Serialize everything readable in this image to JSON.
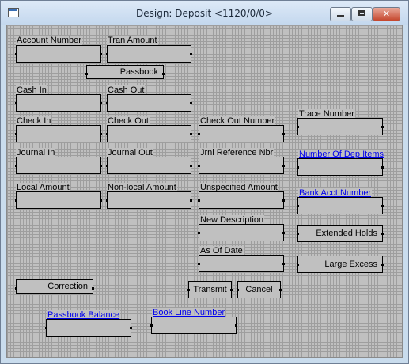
{
  "window": {
    "title": "Design: Deposit <1120/0/0>",
    "controls": {
      "minimize": "minimize",
      "maximize": "maximize",
      "close": "✕"
    }
  },
  "labels": {
    "account_number": "Account Number",
    "tran_amount": "Tran Amount",
    "cash_in": "Cash In",
    "cash_out": "Cash Out",
    "check_in": "Check In",
    "check_out": "Check Out",
    "check_out_number": "Check Out Number",
    "trace_number": "Trace Number",
    "journal_in": "Journal In",
    "journal_out": "Journal Out",
    "jrnl_reference_nbr": "Jrnl Reference Nbr",
    "number_of_dep_items": "Number Of Dep Items",
    "local_amount": "Local Amount",
    "non_local_amount": "Non-local Amount",
    "unspecified_amount": "Unspecified Amount",
    "bank_acct_number": "Bank Acct Number",
    "new_description": "New Description",
    "as_of_date": "As Of Date",
    "passbook_balance": "Passbook Balance",
    "book_line_number": "Book Line Number"
  },
  "buttons": {
    "passbook": "Passbook",
    "extended_holds": "Extended Holds",
    "large_excess": "Large Excess",
    "correction": "Correction",
    "transmit": "Transmit",
    "cancel": "Cancel"
  }
}
